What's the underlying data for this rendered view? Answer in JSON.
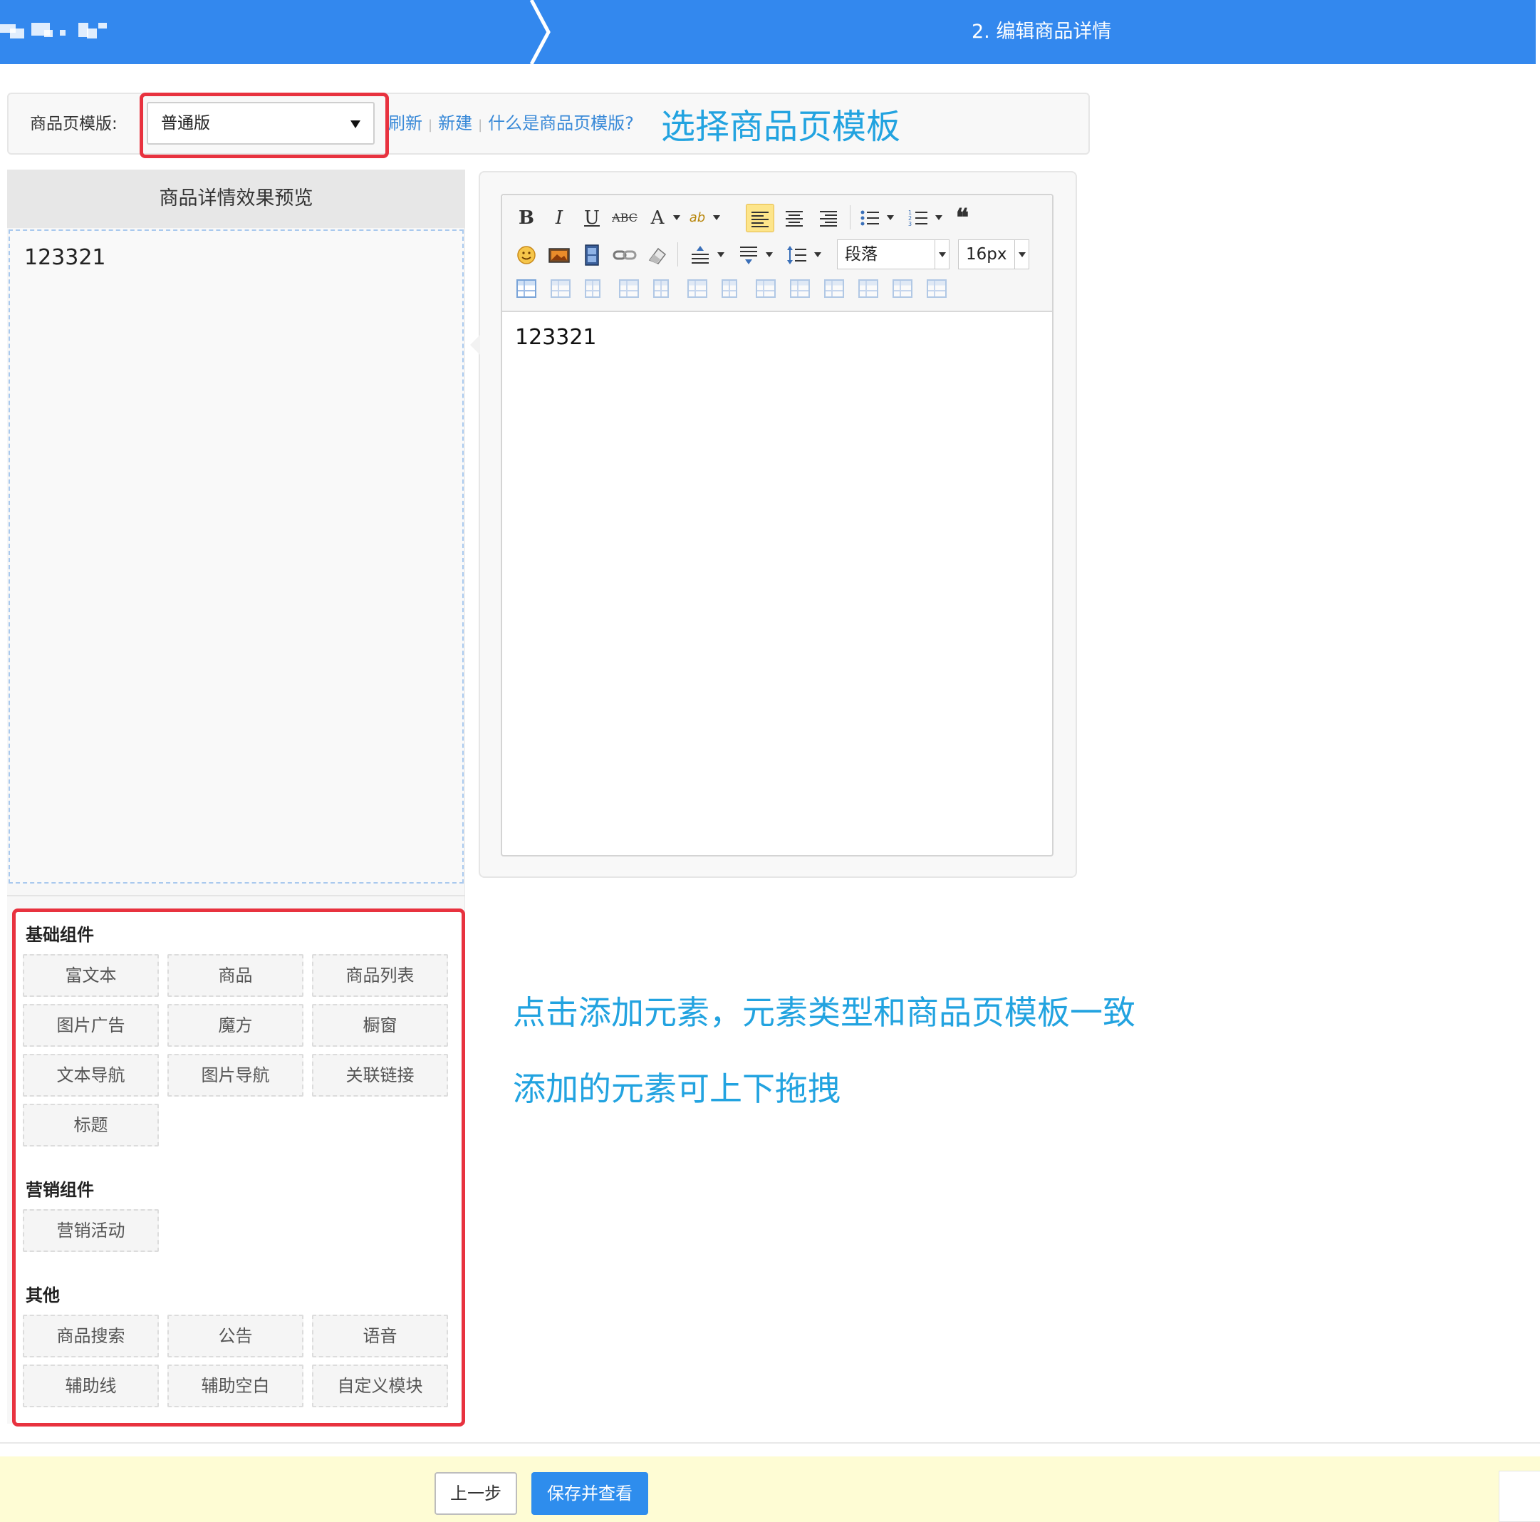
{
  "steps": {
    "step1_label_obscured": true,
    "step2_label": "2. 编辑商品详情"
  },
  "template_bar": {
    "label": "商品页模版:",
    "selected_value": "普通版",
    "links": [
      "刷新",
      "新建",
      "什么是商品页模版?"
    ]
  },
  "annotations": {
    "select_template": "选择商品页模板",
    "click_add": "点击添加元素，元素类型和商品页模板一致",
    "draggable": "添加的元素可上下拖拽"
  },
  "preview": {
    "title": "商品详情效果预览",
    "content": "123321"
  },
  "components": {
    "basic": {
      "title": "基础组件",
      "items": [
        "富文本",
        "商品",
        "商品列表",
        "图片广告",
        "魔方",
        "橱窗",
        "文本导航",
        "图片导航",
        "关联链接",
        "标题"
      ]
    },
    "marketing": {
      "title": "营销组件",
      "items": [
        "营销活动"
      ]
    },
    "other": {
      "title": "其他",
      "items": [
        "商品搜索",
        "公告",
        "语音",
        "辅助线",
        "辅助空白",
        "自定义模块"
      ]
    }
  },
  "editor": {
    "paragraph_format": "段落",
    "font_size": "16px",
    "content": "123321",
    "icons_row1": [
      "bold-icon",
      "italic-icon",
      "underline-icon",
      "strikethrough-icon",
      "font-color-icon",
      "highlight-color-icon",
      "align-left-icon",
      "align-center-icon",
      "align-right-icon",
      "bullet-list-icon",
      "numbered-list-icon",
      "blockquote-icon"
    ],
    "icons_row2": [
      "emoticon-icon",
      "image-icon",
      "video-icon",
      "link-icon",
      "eraser-icon",
      "row-spacing-top-icon",
      "row-spacing-bottom-icon",
      "line-height-icon"
    ],
    "icons_row3": [
      "insert-table-icon",
      "delete-table-icon",
      "table-caption-icon",
      "insert-row-icon",
      "delete-row-icon",
      "insert-col-icon",
      "delete-col-icon",
      "merge-cells-icon",
      "merge-right-icon",
      "merge-down-icon",
      "split-cells-icon",
      "split-rows-icon",
      "split-cols-icon"
    ],
    "accent_active": "#fde58a"
  },
  "footer": {
    "prev_label": "上一步",
    "save_label": "保存并查看"
  },
  "colors": {
    "header_blue": "#3388ee",
    "highlight_red": "#e8323f",
    "annotation_blue": "#22a3e0",
    "link_blue": "#3a8ad8",
    "footer_bg": "#fefcd4"
  }
}
